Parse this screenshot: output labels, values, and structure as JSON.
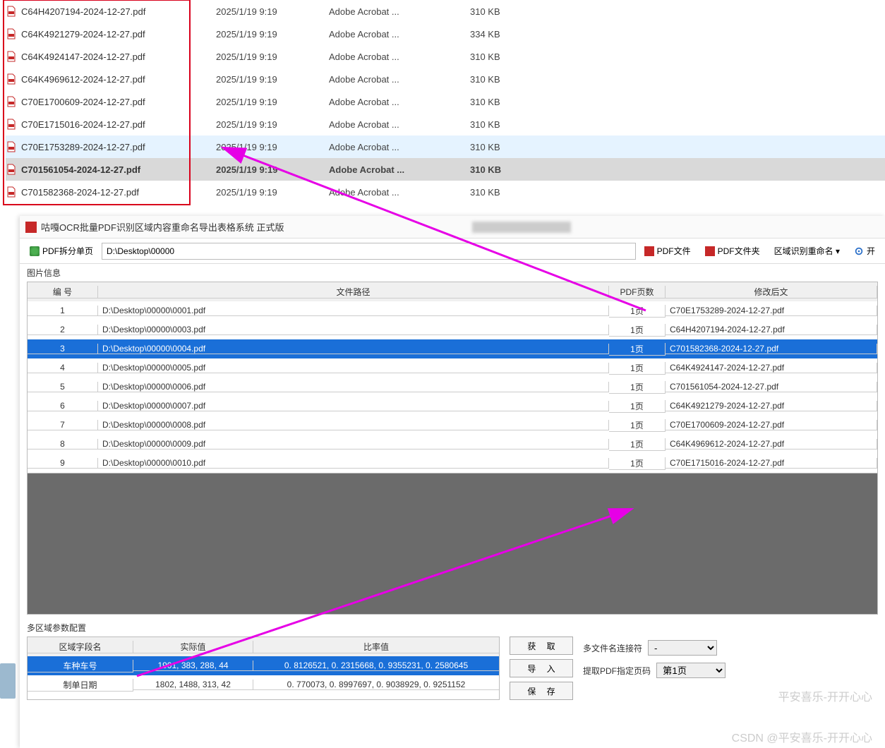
{
  "explorer": {
    "rows": [
      {
        "name": "C64H4207194-2024-12-27.pdf",
        "date": "2025/1/19 9:19",
        "type": "Adobe Acrobat ...",
        "size": "310 KB",
        "state": ""
      },
      {
        "name": "C64K4921279-2024-12-27.pdf",
        "date": "2025/1/19 9:19",
        "type": "Adobe Acrobat ...",
        "size": "334 KB",
        "state": ""
      },
      {
        "name": "C64K4924147-2024-12-27.pdf",
        "date": "2025/1/19 9:19",
        "type": "Adobe Acrobat ...",
        "size": "310 KB",
        "state": ""
      },
      {
        "name": "C64K4969612-2024-12-27.pdf",
        "date": "2025/1/19 9:19",
        "type": "Adobe Acrobat ...",
        "size": "310 KB",
        "state": ""
      },
      {
        "name": "C70E1700609-2024-12-27.pdf",
        "date": "2025/1/19 9:19",
        "type": "Adobe Acrobat ...",
        "size": "310 KB",
        "state": ""
      },
      {
        "name": "C70E1715016-2024-12-27.pdf",
        "date": "2025/1/19 9:19",
        "type": "Adobe Acrobat ...",
        "size": "310 KB",
        "state": ""
      },
      {
        "name": "C70E1753289-2024-12-27.pdf",
        "date": "2025/1/19 9:19",
        "type": "Adobe Acrobat ...",
        "size": "310 KB",
        "state": "hov"
      },
      {
        "name": "C701561054-2024-12-27.pdf",
        "date": "2025/1/19 9:19",
        "type": "Adobe Acrobat ...",
        "size": "310 KB",
        "state": "sel"
      },
      {
        "name": "C701582368-2024-12-27.pdf",
        "date": "2025/1/19 9:19",
        "type": "Adobe Acrobat ...",
        "size": "310 KB",
        "state": ""
      }
    ]
  },
  "app": {
    "title": "咕嘎OCR批量PDF识别区域内容重命名导出表格系统  正式版",
    "toolbar": {
      "split_btn": "PDF拆分单页",
      "path": "D:\\Desktop\\00000",
      "pdf_file": "PDF文件",
      "pdf_folder": "PDF文件夹",
      "region_rename": "区域识别重命名 ▾",
      "open": "开"
    },
    "section_img": "图片信息",
    "grid_headers": {
      "c1": "编 号",
      "c2": "文件路径",
      "c3": "PDF页数",
      "c4": "修改后文"
    },
    "rows": [
      {
        "n": "1",
        "path": "D:\\Desktop\\00000\\0001.pdf",
        "pages": "1页",
        "newname": "C70E1753289-2024-12-27.pdf"
      },
      {
        "n": "2",
        "path": "D:\\Desktop\\00000\\0003.pdf",
        "pages": "1页",
        "newname": "C64H4207194-2024-12-27.pdf"
      },
      {
        "n": "3",
        "path": "D:\\Desktop\\00000\\0004.pdf",
        "pages": "1页",
        "newname": "C701582368-2024-12-27.pdf"
      },
      {
        "n": "4",
        "path": "D:\\Desktop\\00000\\0005.pdf",
        "pages": "1页",
        "newname": "C64K4924147-2024-12-27.pdf"
      },
      {
        "n": "5",
        "path": "D:\\Desktop\\00000\\0006.pdf",
        "pages": "1页",
        "newname": "C701561054-2024-12-27.pdf"
      },
      {
        "n": "6",
        "path": "D:\\Desktop\\00000\\0007.pdf",
        "pages": "1页",
        "newname": "C64K4921279-2024-12-27.pdf"
      },
      {
        "n": "7",
        "path": "D:\\Desktop\\00000\\0008.pdf",
        "pages": "1页",
        "newname": "C70E1700609-2024-12-27.pdf"
      },
      {
        "n": "8",
        "path": "D:\\Desktop\\00000\\0009.pdf",
        "pages": "1页",
        "newname": "C64K4969612-2024-12-27.pdf"
      },
      {
        "n": "9",
        "path": "D:\\Desktop\\00000\\0010.pdf",
        "pages": "1页",
        "newname": "C70E1715016-2024-12-27.pdf"
      }
    ],
    "selected_row_index": 2,
    "section_cfg": "多区域参数配置",
    "cfg_headers": {
      "c1": "区域字段名",
      "c2": "实际值",
      "c3": "比率值"
    },
    "cfg_rows": [
      {
        "f": "车种车号",
        "a": "1901, 383, 288, 44",
        "r": "0. 8126521, 0. 2315668, 0. 9355231, 0. 2580645",
        "sel": true
      },
      {
        "f": "制单日期",
        "a": "1802, 1488, 313, 42",
        "r": "0. 770073, 0. 8997697, 0. 9038929, 0. 9251152",
        "sel": false
      }
    ],
    "buttons": {
      "get": "获 取",
      "import": "导 入",
      "save": "保 存"
    },
    "opts": {
      "joiner_label": "多文件名连接符",
      "joiner_value": "-",
      "page_label": "提取PDF指定页码",
      "page_value": "第1页"
    }
  },
  "watermark": "CSDN @平安喜乐-开开心心",
  "watermark2": "平安喜乐-开开心心"
}
